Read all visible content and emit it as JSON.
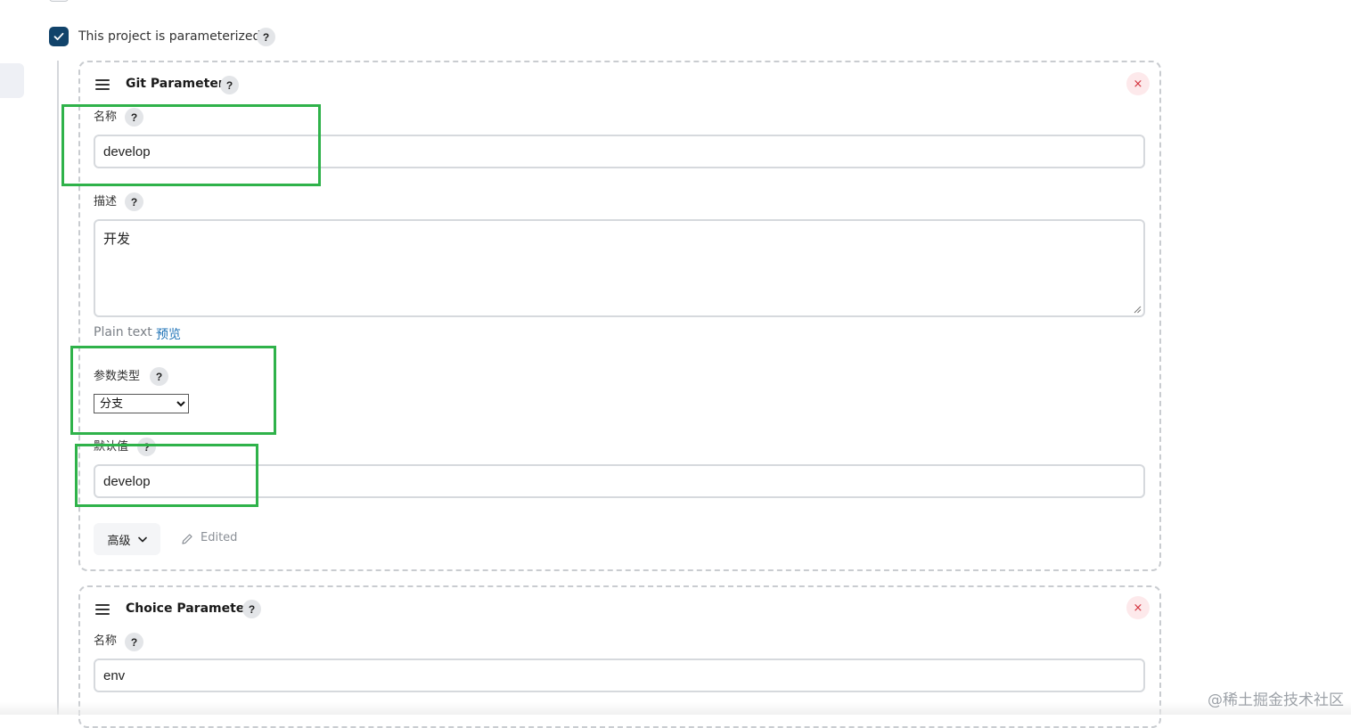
{
  "colors": {
    "accent": "#11436a",
    "link": "#1f73b7",
    "danger": "#d32f3a",
    "highlight": "#2fb24a"
  },
  "parameterized": {
    "checked": true,
    "label": "This project is parameterized",
    "help": "?"
  },
  "git_parameter": {
    "title": "Git Parameter",
    "help": "?",
    "close_icon": "×",
    "name": {
      "label": "名称",
      "help": "?",
      "value": "develop"
    },
    "description": {
      "label": "描述",
      "help": "?",
      "value": "开发",
      "format_text": "Plain text",
      "preview_link": "预览"
    },
    "param_type": {
      "label": "参数类型",
      "help": "?",
      "selected": "分支",
      "options": [
        "分支"
      ]
    },
    "default_value": {
      "label": "默认值",
      "help": "?",
      "value": "develop"
    },
    "advanced": {
      "label": "高级",
      "icon": "chevron-down-icon"
    },
    "edited": {
      "label": "Edited",
      "icon": "pencil-icon"
    }
  },
  "choice_parameter": {
    "title": "Choice Parameter",
    "help": "?",
    "close_icon": "×",
    "name": {
      "label": "名称",
      "help": "?",
      "value": "env"
    }
  },
  "watermark": "@稀土掘金技术社区"
}
